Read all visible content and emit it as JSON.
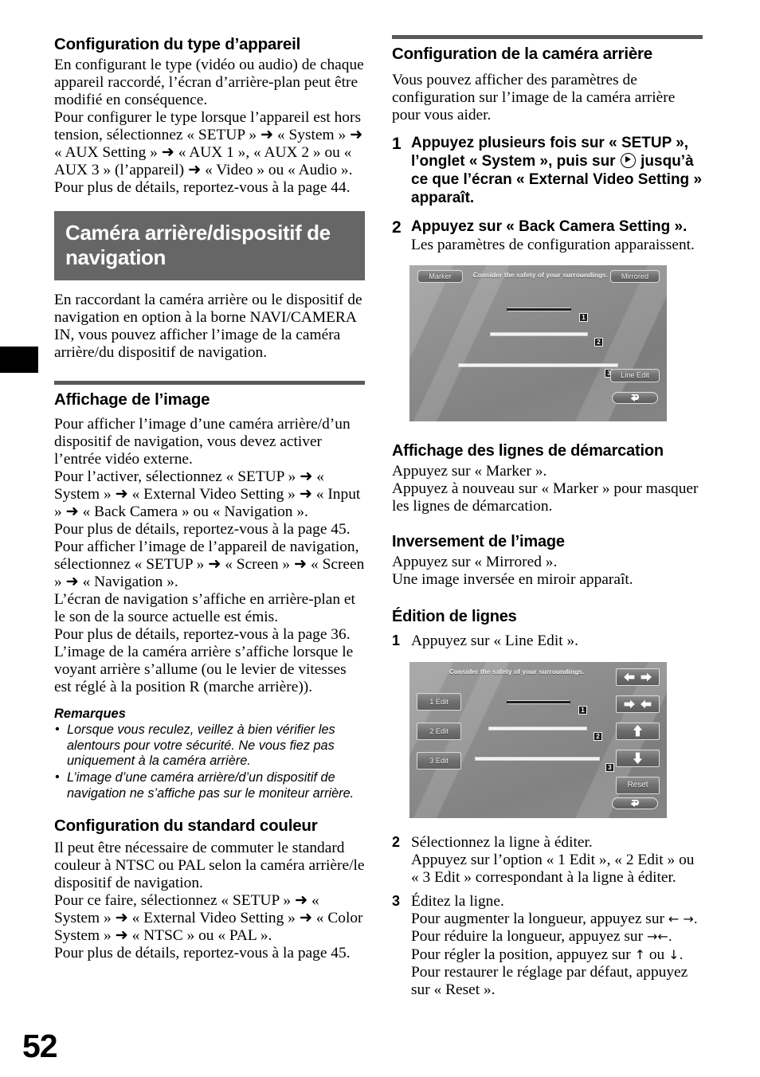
{
  "page": {
    "number": "52"
  },
  "left_column": {
    "section1": {
      "title": "Configuration du type d’appareil",
      "paragraphs": [
        "En configurant le type (vidéo ou audio) de chaque appareil raccordé, l’écran d’arrière-plan peut être modifié en conséquence.",
        "Pour configurer le type lorsque l’appareil est hors tension, sélectionnez « SETUP » ➜ « System » ➜ « AUX Setting » ➜ « AUX 1 », « AUX 2 » ou « AUX 3 » (l’appareil) ➜ « Video » ou « Audio ».",
        "Pour plus de détails, reportez-vous à la page 44."
      ]
    },
    "chapter_banner": "Caméra arrière/dispositif de navigation",
    "chapter_intro": "En raccordant la caméra arrière ou le dispositif de navigation en option à la borne NAVI/CAMERA IN, vous pouvez afficher l’image de la caméra arrière/du dispositif de navigation.",
    "section2": {
      "title": "Affichage de l’image",
      "paragraph1": "Pour afficher l’image d’une caméra arrière/d’un dispositif de navigation, vous devez activer l’entrée vidéo externe.",
      "paragraph2": "Pour l’activer, sélectionnez « SETUP » ➜ « System » ➜ « External Video Setting » ➜ « Input » ➜ « Back Camera » ou « Navigation ».",
      "paragraph3": "Pour plus de détails, reportez-vous à la page 45.",
      "paragraph4": "Pour afficher l’image de l’appareil de navigation, sélectionnez « SETUP » ➜ « Screen » ➜ « Screen » ➜ « Navigation ».",
      "paragraph5": "L’écran de navigation s’affiche en arrière-plan et le son de la source actuelle est émis.",
      "paragraph6": "Pour plus de détails, reportez-vous à la page 36.",
      "paragraph7": "L’image de la caméra arrière s’affiche lorsque le voyant arrière s’allume (ou le levier de vitesses est réglé à la position R (marche arrière))."
    },
    "remarks": {
      "title": "Remarques",
      "items": [
        "Lorsque vous reculez, veillez à bien vérifier les alentours pour votre sécurité. Ne vous fiez pas uniquement à la caméra arrière.",
        "L’image d’une caméra arrière/d’un dispositif de navigation ne s’affiche pas sur le moniteur arrière."
      ]
    },
    "section3": {
      "title": "Configuration du standard couleur",
      "paragraph1": "Il peut être nécessaire de commuter le standard couleur à NTSC ou PAL selon la caméra arrière/le dispositif de navigation.",
      "paragraph2": "Pour ce faire, sélectionnez « SETUP » ➜ « System » ➜ « External Video Setting » ➜ « Color System » ➜ « NTSC » ou « PAL ».",
      "paragraph3": "Pour plus de détails, reportez-vous à la page 45."
    }
  },
  "right_column": {
    "section1": {
      "title": "Configuration de la caméra arrière",
      "intro": "Vous pouvez afficher des paramètres de configuration sur l’image de la caméra arrière pour vous aider.",
      "steps": [
        {
          "number": "1",
          "lead_part1": "Appuyez plusieurs fois sur « SETUP », l’onglet « System », puis sur",
          "lead_part2": "jusqu’à ce que l’écran « External Video Setting » apparaît."
        },
        {
          "number": "2",
          "lead_part1": "Appuyez sur « Back Camera Setting ».",
          "sub": "Les paramètres de configuration apparaissent."
        }
      ]
    },
    "figure1": {
      "caption": "Consider the safety of your surroundings.",
      "marker_button": "Marker",
      "mirrored_button": "Mirrored",
      "line_edit_button": "Line Edit",
      "back_button": "back-arrow",
      "line_labels": [
        "1",
        "2",
        "3"
      ]
    },
    "section2": {
      "title": "Affichage des lignes de démarcation",
      "paragraph1": "Appuyez sur « Marker ».",
      "paragraph2": "Appuyez à nouveau sur « Marker » pour masquer les lignes de démarcation."
    },
    "section3": {
      "title": "Inversement de l’image",
      "paragraph1": "Appuyez sur « Mirrored ».",
      "paragraph2": "Une image inversée en miroir apparaît."
    },
    "section4": {
      "title": "Édition de lignes",
      "step1": {
        "number": "1",
        "text": "Appuyez sur « Line Edit »."
      },
      "step2": {
        "number": "2",
        "line1": "Sélectionnez la ligne à éditer.",
        "line2": "Appuyez sur l’option « 1 Edit », « 2 Edit » ou « 3 Edit » correspondant à la ligne à éditer."
      },
      "step3": {
        "number": "3",
        "line1": "Éditez la ligne.",
        "line2_a": "Pour augmenter la longueur, appuyez sur",
        "line2_b": "← →.",
        "line3_a": "Pour réduire la longueur, appuyez sur",
        "line3_b": "→←.",
        "line4_a": "Pour régler la position, appuyez sur",
        "line4_b": "↑",
        "line4_c": "ou",
        "line4_d": "↓.",
        "line5": "Pour restaurer le réglage par défaut, appuyez sur « Reset »."
      }
    },
    "figure2": {
      "caption": "Consider the safety of your surroundings.",
      "edit_buttons": [
        "1 Edit",
        "2 Edit",
        "3 Edit"
      ],
      "reset_button": "Reset",
      "back_button": "back-arrow",
      "line_labels": [
        "1",
        "2",
        "3"
      ],
      "arrow_buttons": [
        "expand-horizontal",
        "contract-horizontal",
        "move-up",
        "move-down"
      ]
    }
  },
  "colors": {
    "chapter_banner_bg": "#666666",
    "rule_gray": "#595959",
    "device_bg": "#8d8d8d"
  }
}
